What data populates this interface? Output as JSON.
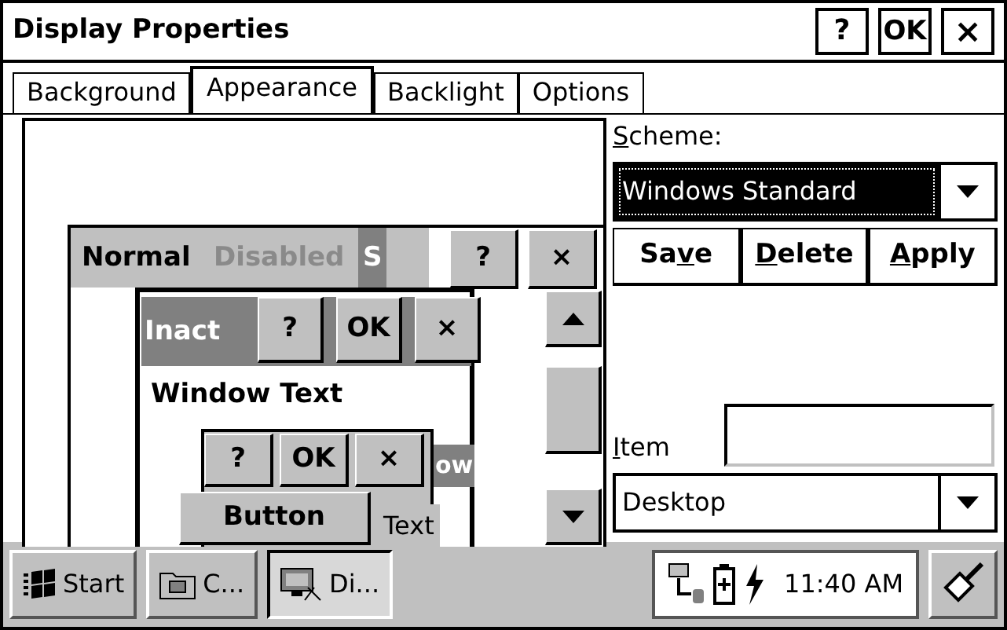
{
  "window": {
    "title": "Display Properties",
    "buttons": [
      {
        "kind": "help",
        "label": "?"
      },
      {
        "kind": "ok",
        "label": "OK"
      },
      {
        "kind": "close",
        "label": "×"
      }
    ]
  },
  "tabs": [
    {
      "label": "Background",
      "selected": false
    },
    {
      "label": "Appearance",
      "selected": true
    },
    {
      "label": "Backlight",
      "selected": false
    },
    {
      "label": "Options",
      "selected": false
    }
  ],
  "preview": {
    "active_window": {
      "title_parts": [
        {
          "text": "Normal",
          "kind": "normal"
        },
        {
          "text": "Disabled",
          "kind": "disabled"
        },
        {
          "text": "S",
          "kind": "selected"
        }
      ],
      "buttons": [
        "?",
        "×"
      ]
    },
    "inactive_window": {
      "title": "Inact",
      "buttons": [
        "?",
        "OK",
        "×"
      ],
      "window_text": "Window Text"
    },
    "message_box": {
      "buttons": [
        "?",
        "OK",
        "×"
      ],
      "title": "ow",
      "text": "Text"
    },
    "button": "Button"
  },
  "scheme": {
    "label": {
      "key": "S",
      "after": "cheme:"
    },
    "value": "Windows Standard"
  },
  "scheme_buttons": [
    {
      "before": "Sa",
      "key": "v",
      "after": "e"
    },
    {
      "key": "D",
      "after": "elete"
    },
    {
      "key": "A",
      "after": "pply"
    }
  ],
  "item": {
    "label": {
      "key": "I",
      "after": "tem"
    },
    "value": "Desktop"
  },
  "taskbar": {
    "start": "Start",
    "tasks": [
      {
        "label": "C...",
        "kind": "folder",
        "selected": false
      },
      {
        "label": "Di...",
        "kind": "display",
        "selected": true
      }
    ],
    "clock": "11:40 AM"
  }
}
